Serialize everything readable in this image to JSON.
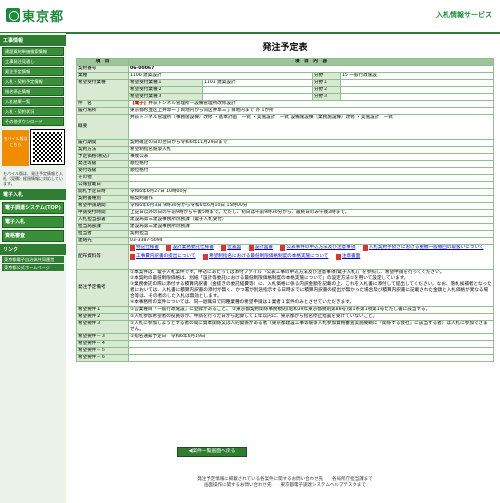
{
  "header": {
    "logo": "東京都",
    "service": "入札情報サービス"
  },
  "sidebar": {
    "head1": "工事情報",
    "items": [
      "建設資材単価検索情報",
      "工事発注見通し",
      "発注予定情報",
      "入札・契約予定情報",
      "指名停止情報",
      "入札結果一覧",
      "入札・契約状況",
      "その他ダウンロード"
    ],
    "mobile_label": "モバイル版はこちら",
    "mobile_note": "モバイル版は、発注予定情報と入札（見積）経過情報に対応しています。",
    "head2": "電子入札",
    "buttons": [
      "電子調達システム(TOP)",
      "電子入札",
      "資格審査"
    ],
    "head3": "リンク",
    "links": [
      "東京都電子自治体共同運営",
      "東京都公式ホームページ"
    ]
  },
  "page": {
    "title": "発注予定表"
  },
  "table": {
    "col1": "項　目",
    "col2": "項　目　内　容",
    "rows": {
      "keiyaku_no": {
        "label": "契約番号",
        "value": "06-00067"
      },
      "gyoshu": {
        "label": "業種",
        "v1": "1100 建築設計",
        "v2": "分野",
        "v3": "15 一般行政施設"
      },
      "kibou": {
        "label": "希望受付業種",
        "r1a": "希望受付業種１",
        "r1b": "1101 建築設計",
        "r1c": "分野１",
        "r2a": "希望受付業種２",
        "r2c": "分野２",
        "r3a": "希望受付業種３",
        "r3c": "分野３"
      },
      "kenmei": {
        "label": "件　名",
        "tag": "【電子】",
        "value": "井荻トンネル管理所－設備管理所改修設計"
      },
      "basho": {
        "label": "履行場所",
        "value": "東京都杉並区上井草一丁目地内から同区井草三丁目地内まで 外 1か所"
      },
      "gaiyou": {
        "label": "概要",
        "value": "井荻トンネル管理所（事務施設棟）改修 ・基本計画　一式 ・実施設計　一式 設備施設棟（業務施設棟）改修 ・実施設計　一式"
      },
      "kikan": {
        "label": "履行期間",
        "value": "契約確定の日の翌日から令和6年11月29日まで"
      },
      "houhou": {
        "label": "契約方法",
        "value": "希望制指名競争入札"
      },
      "yotei": {
        "label": "予定価格(税込)",
        "value": "事後公表"
      },
      "hacchu": {
        "label": "発注等級",
        "value": "順位格付"
      },
      "juchu": {
        "label": "受付等級",
        "value": "順位格付"
      },
      "sonota": {
        "label": "その他",
        "value": ""
      },
      "koukoku": {
        "label": "公報登載日",
        "value": ""
      },
      "kaihi": {
        "label": "開札予定日時",
        "value": "令和6年6月27日 10時00分"
      },
      "keiyaku_kakuho": {
        "label": "契約書種別",
        "value": "紙契約書作"
      },
      "shinsei": {
        "label": "希望申請期間",
        "value": "令和6年6月3日 9時30分から令和6年6月10日 15時00分"
      },
      "uketsuke": {
        "label": "申請受付時間",
        "value": "上記日以外の日の午前9時から午後5時まで。ただし、初日は午前9時30分から、最終日のみ午後3時まで。"
      },
      "tantou": {
        "label": "入札担当部署",
        "value": "建設局第三建設事務所庶務課（電子入札受付）"
      },
      "tanto2": {
        "label": "担当局部課",
        "value": "建設局第三建設事務所庶務課"
      },
      "tanto3": {
        "label": "担当者",
        "value": "契約担当"
      },
      "renraku": {
        "label": "連絡先",
        "value": "03-3387-5094"
      },
      "haifu": {
        "label": "配布資料等",
        "docs": [
          "特記仕様書",
          "設計業務委託仕様書",
          "位置図",
          "設計図書",
          "公表事件の申込方法及び注意事項",
          "入札契約手続きにおける重機一般撤回の取扱いについて",
          "工事費内訳書の提出について",
          "希望制指名における最低制限価格制度の本格実施について",
          "注意書面"
        ]
      },
      "hacchu_yotei": {
        "label": "発注予定備考",
        "p1": "①本案件は、電子入札案件です。申込にあたっては添付ファイル「公表工事の申込方法及び注意事項(電子入札)」を参照し、希望申請を行ってください。",
        "p2": "②本契約の最低制限価格は、別紙「設計等委託における最低制限価格制度の本格実施について」の設定方法①を用いて設定しています。",
        "p3": "③業務委託の際に添付する積算内訳書（金抜きの委託経費等）に、入札価格に係る内訳金額を記載の上、これを入札書に添付して提出してください。なお、落札候補者となった者においては、入札書に積算内訳書の添付が無く、かつ署が別途指示する日時までに積算内訳書の提出が無かった場合及び積算内訳書に記載された金額と入札価格が異なる場合等は、その者のした入札は無効とします。",
        "p4": "④本事務所の案件については、同一退職日で同種業種の希望申請は１業者１案件のみとさせていただきます。"
      },
      "joken1": {
        "label": "希望要件１",
        "value": "①営業種目「一般行政施設」に登録があること。 ②東京都契約関係事務規則(昭和39年東京都規則第88号)第1条第1項第1号ただし書に該当する。"
      },
      "joken2": {
        "label": "希望要件２",
        "value": "①入札参加希望者の役員等が、申請を行った日から起算して１年以内に、東京都から指名停止措置を受けていないこと。"
      },
      "joken3": {
        "label": "希望要件３",
        "value": "①入札に参加しようとする者の間に資本関係又は人的関係がある者（東京都建設工事等競争入札参加資格審査実施要綱に「関係する会社」に該当する者）は入札に参加できません。"
      },
      "joken4": {
        "label": "希望要件－３",
        "value": "①指名通知予定日　令和6年6月19日"
      },
      "joken5": {
        "label": "希望要件－４",
        "value": ""
      },
      "joken6": {
        "label": "希望要件－５",
        "value": ""
      },
      "joken7": {
        "label": "希望要件－６",
        "value": ""
      }
    }
  },
  "back_button": "◀案件一覧画面へ戻る",
  "footer": {
    "line1": "発注予定情報に掲載されている各案件に関するお問い合わせ先　　各局所庁担当課まで",
    "line2": "画面操作に関するお問い合わせ先　　東京都電子調達システムヘルプデスクまで"
  }
}
